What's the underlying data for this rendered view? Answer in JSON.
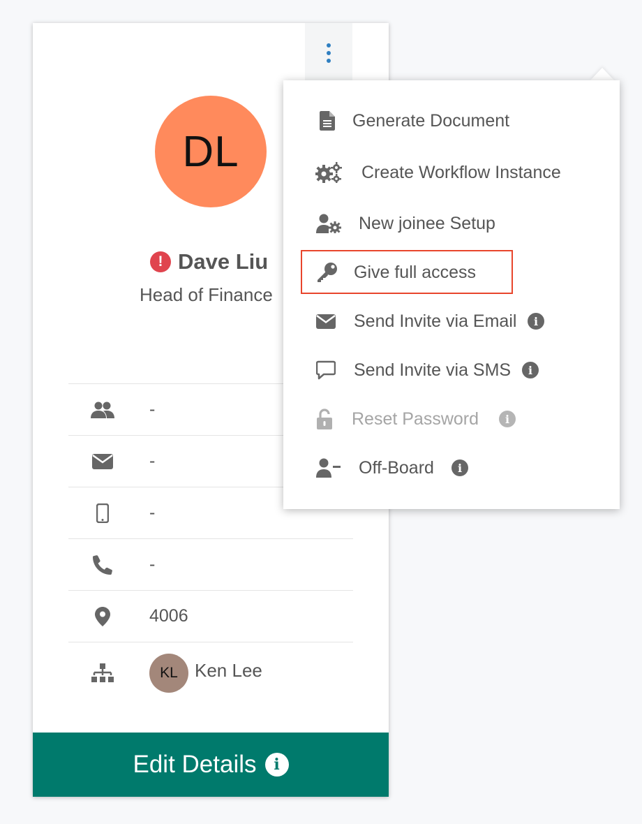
{
  "profile": {
    "initials": "DL",
    "avatar_color": "#ff8a5c",
    "name": "Dave Liu",
    "status_icon": "exclamation-icon",
    "job_title": "Head of Finance"
  },
  "details": {
    "team": "-",
    "email": "-",
    "mobile": "-",
    "phone": "-",
    "location": "4006",
    "manager": {
      "initials": "KL",
      "name": "Ken Lee"
    }
  },
  "edit_button": {
    "label": "Edit Details"
  },
  "menu": {
    "items": [
      {
        "label": "Generate Document",
        "icon": "document-icon"
      },
      {
        "label": "Create Workflow Instance",
        "icon": "gears-icon"
      },
      {
        "label": "New joinee Setup",
        "icon": "user-cog-icon"
      },
      {
        "label": "Give full access",
        "icon": "key-icon"
      },
      {
        "label": "Send Invite via Email",
        "icon": "envelope-icon"
      },
      {
        "label": "Send Invite via SMS",
        "icon": "comment-icon"
      },
      {
        "label": "Reset Password",
        "icon": "unlock-icon",
        "disabled": true
      },
      {
        "label": "Off-Board",
        "icon": "user-minus-icon"
      }
    ],
    "highlighted": "Give full access"
  },
  "colors": {
    "accent": "#007a6c",
    "link": "#2f7fc1",
    "warning": "#e0444e",
    "highlight_border": "#e8452c"
  }
}
